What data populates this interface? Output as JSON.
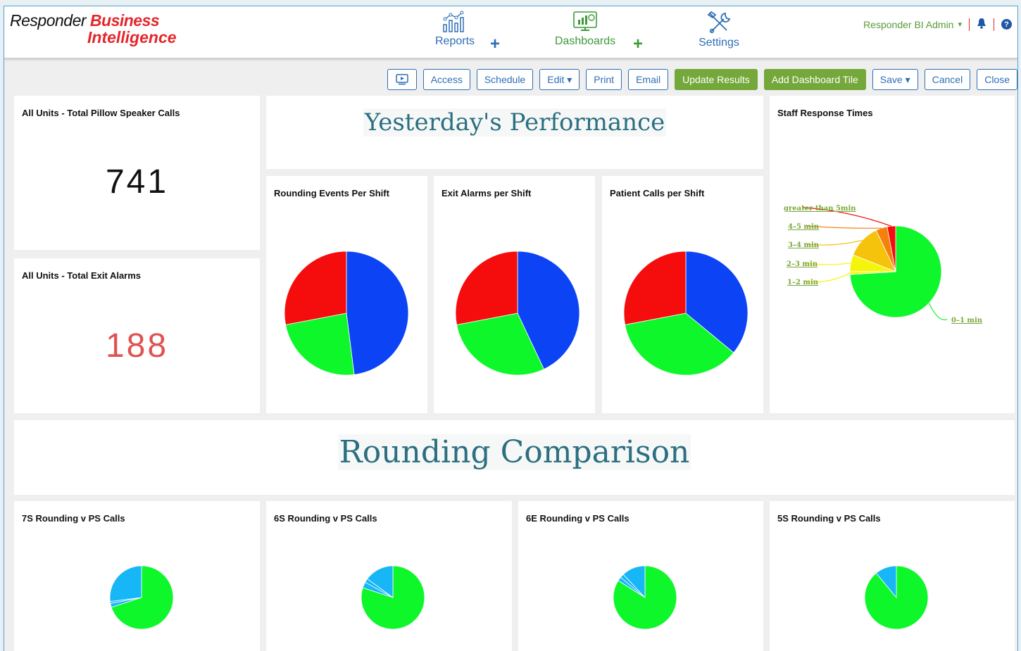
{
  "app": {
    "logo_part1": "Responder",
    "logo_part2": "Business",
    "logo_part3": "Intelligence"
  },
  "nav": {
    "reports": "Reports",
    "dashboards": "Dashboards",
    "settings": "Settings",
    "plus_symbol": "+"
  },
  "user": {
    "name": "Responder BI Admin",
    "caret": "▾",
    "bell": "🔔",
    "help": "?"
  },
  "toolbar": {
    "access": "Access",
    "schedule": "Schedule",
    "edit": "Edit ▾",
    "print": "Print",
    "email": "Email",
    "update": "Update Results",
    "add_tile": "Add Dashboard Tile",
    "save": "Save ▾",
    "cancel": "Cancel",
    "close": "Close"
  },
  "tiles": {
    "pillow_title": "All Units - Total Pillow Speaker Calls",
    "pillow_value": "741",
    "exit_title": "All Units - Total Exit Alarms",
    "exit_value": "188",
    "yesterday_heading": "Yesterday's Performance",
    "rounding_heading": "Rounding Comparison",
    "rounding_events_title": "Rounding Events Per Shift",
    "exit_shift_title": "Exit Alarms per Shift",
    "patient_calls_title": "Patient Calls per Shift",
    "staff_response_title": "Staff Response Times",
    "r7s_title": "7S Rounding v PS Calls",
    "r6s_title": "6S Rounding v PS Calls",
    "r6e_title": "6E Rounding v PS Calls",
    "r5s_title": "5S Rounding v PS Calls"
  },
  "colors": {
    "blue": "#0c44f5",
    "green": "#0df72a",
    "red": "#f50c0c",
    "lightblue": "#17b6f7",
    "gold": "#f5c20c",
    "yellow": "#f5f50c",
    "orange": "#f5800c",
    "black": "#111111",
    "pillow_value": "#111111",
    "exit_value": "#e05252"
  },
  "chart_data": [
    {
      "type": "pie",
      "name": "rounding-events",
      "values": [
        0.48,
        0.24,
        0.28
      ],
      "colors": [
        "blue",
        "green",
        "red"
      ]
    },
    {
      "type": "pie",
      "name": "exit-alarms",
      "values": [
        0.43,
        0.29,
        0.28
      ],
      "colors": [
        "blue",
        "green",
        "red"
      ]
    },
    {
      "type": "pie",
      "name": "patient-calls",
      "values": [
        0.36,
        0.36,
        0.28
      ],
      "colors": [
        "blue",
        "green",
        "red"
      ]
    },
    {
      "type": "pie",
      "name": "staff-response",
      "categories": [
        "0-1 min",
        "1-2 min",
        "2-3 min",
        "3-4 min",
        "4-5 min",
        "greater than 5min"
      ],
      "labels": [
        "0–1 min",
        "1–2 min",
        "2–3 min",
        "3–4 min",
        "4–5 min",
        "greater than 5min"
      ],
      "values": [
        0.74,
        0.01,
        0.06,
        0.12,
        0.04,
        0.03
      ],
      "colors": [
        "green",
        "yellow",
        "yellow",
        "gold",
        "orange",
        "red"
      ]
    },
    {
      "type": "pie",
      "name": "7s",
      "values": [
        0.7,
        0.02,
        0.01,
        0.27
      ],
      "colors": [
        "green",
        "lightblue",
        "lightblue",
        "lightblue"
      ]
    },
    {
      "type": "pie",
      "name": "6s",
      "values": [
        0.8,
        0.03,
        0.02,
        0.15
      ],
      "colors": [
        "green",
        "lightblue",
        "lightblue",
        "lightblue"
      ]
    },
    {
      "type": "pie",
      "name": "6e",
      "values": [
        0.84,
        0.02,
        0.02,
        0.12
      ],
      "colors": [
        "green",
        "lightblue",
        "lightblue",
        "lightblue"
      ]
    },
    {
      "type": "pie",
      "name": "5s",
      "values": [
        0.89,
        0.11
      ],
      "colors": [
        "green",
        "lightblue"
      ]
    }
  ]
}
